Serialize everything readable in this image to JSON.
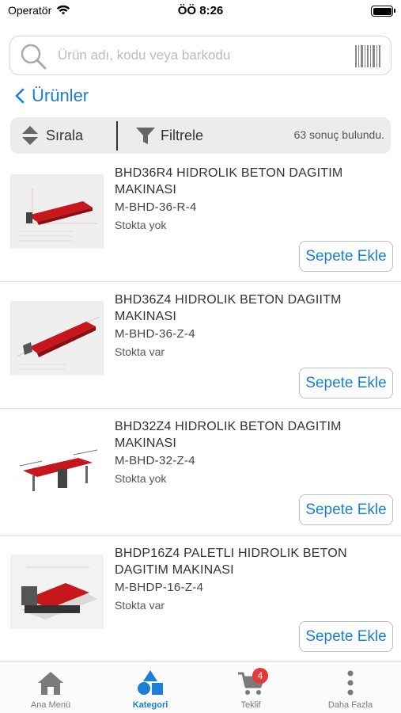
{
  "status_bar": {
    "carrier": "Operatör",
    "time": "ÖÖ 8:26"
  },
  "search": {
    "placeholder": "Ürün adı, kodu veya barkodu"
  },
  "nav": {
    "back_label": "Ürünler"
  },
  "toolbar": {
    "sort_label": "Sırala",
    "filter_label": "Filtrele",
    "result_count": "63 sonuç bulundu."
  },
  "products": [
    {
      "name": "BHD36R4 HIDROLIK BETON DAGITIM MAKINASI",
      "code": "M-BHD-36-R-4",
      "stock": "Stokta yok",
      "button": "Sepete Ekle"
    },
    {
      "name": "BHD36Z4 HIDROLIK BETON DAGIITM MAKINASI",
      "code": "M-BHD-36-Z-4",
      "stock": "Stokta var",
      "button": "Sepete Ekle"
    },
    {
      "name": "BHD32Z4 HIDROLIK BETON DAGITIM MAKINASI",
      "code": "M-BHD-32-Z-4",
      "stock": "Stokta yok",
      "button": "Sepete Ekle"
    },
    {
      "name": "BHDP16Z4 PALETLI HIDROLIK BETON DAGITIM MAKINASI",
      "code": "M-BHDP-16-Z-4",
      "stock": "Stokta var",
      "button": "Sepete Ekle"
    }
  ],
  "tabs": [
    {
      "label": "Ana Menü",
      "icon": "home-icon",
      "active": false
    },
    {
      "label": "Kategori",
      "icon": "category-icon",
      "active": true
    },
    {
      "label": "Teklif",
      "icon": "cart-icon",
      "active": false,
      "badge": "4"
    },
    {
      "label": "Daha Fazla",
      "icon": "more-icon",
      "active": false
    }
  ],
  "colors": {
    "accent": "#1a7fd6",
    "badge": "#e53935",
    "tab_inactive": "#7a7a7a"
  }
}
